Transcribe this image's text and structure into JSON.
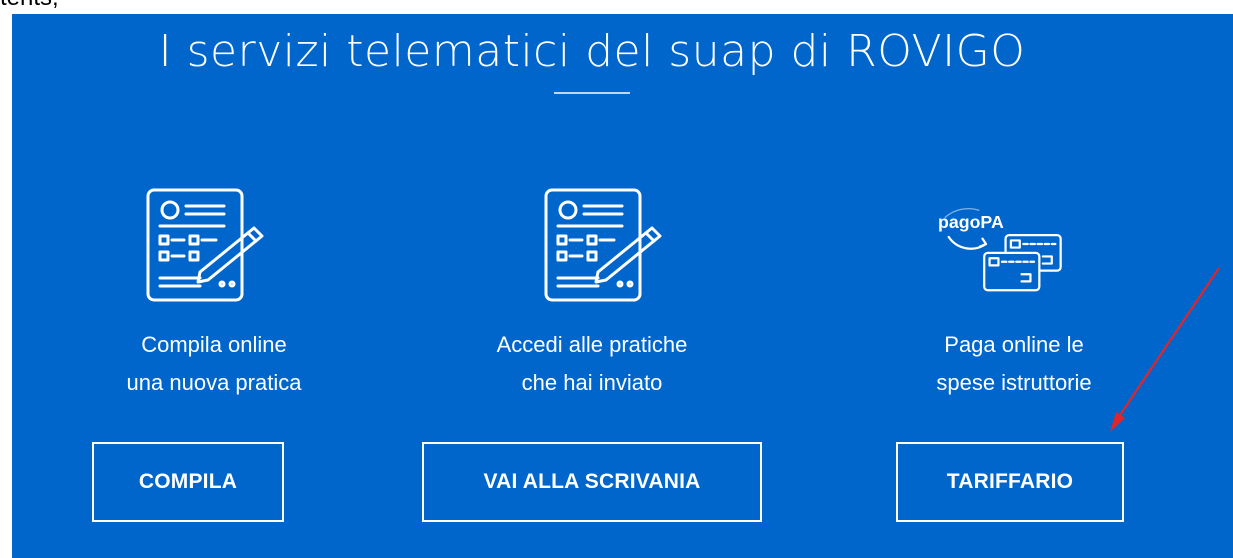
{
  "top_strip": {
    "text": "tents;"
  },
  "header": {
    "title": "I servizi telematici del suap di ROVIGO"
  },
  "cards": [
    {
      "icon": "form-edit-icon",
      "line1": "Compila online",
      "line2": "una nuova pratica",
      "button_label": "COMPILA"
    },
    {
      "icon": "form-edit-icon",
      "line1": "Accedi alle pratiche",
      "line2": "che hai inviato",
      "button_label": "VAI ALLA SCRIVANIA"
    },
    {
      "icon": "pagopa-cards-icon",
      "icon_text": "pagoPA",
      "line1": "Paga online le",
      "line2": "spese istruttorie",
      "button_label": "TARIFFARIO"
    }
  ],
  "colors": {
    "panel_bg": "#0066cc",
    "text": "#ffffff",
    "arrow": "#e0262b"
  }
}
